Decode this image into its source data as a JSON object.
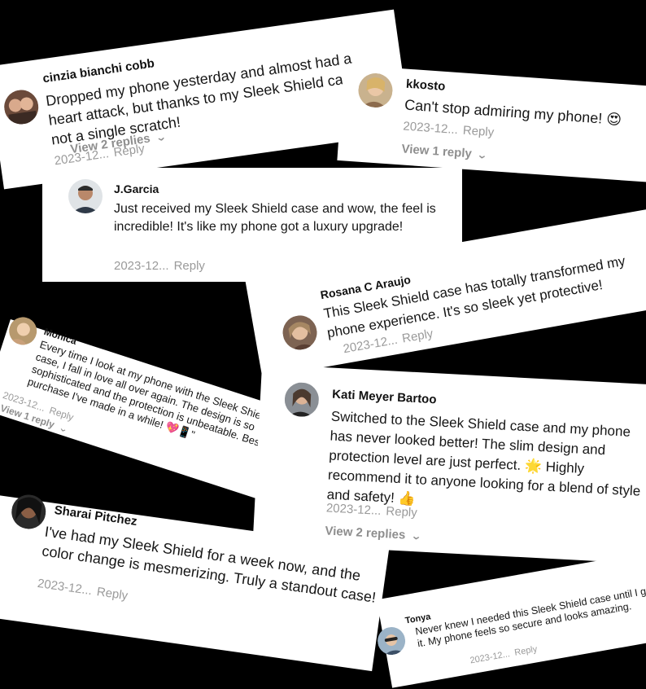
{
  "comments": [
    {
      "username": "cinzia bianchi cobb",
      "text": "Dropped my phone yesterday and almost had a heart attack, but thanks to my Sleek Shield case, not a single scratch!",
      "date": "2023-12...",
      "reply": "Reply",
      "view_replies": "View 2 replies"
    },
    {
      "username": "kkosto",
      "text": "Can't stop admiring my phone! 😍",
      "date": "2023-12...",
      "reply": "Reply",
      "view_replies": "View 1 reply"
    },
    {
      "username": "J.Garcia",
      "text": "Just received my Sleek Shield case and wow, the feel is incredible! It's like my phone got a luxury upgrade!",
      "date": "2023-12...",
      "reply": "Reply"
    },
    {
      "username": "Rosana C Araujo",
      "text": "This Sleek Shield case has totally transformed my phone experience. It's so sleek yet protective!",
      "date": "2023-12...",
      "reply": "Reply"
    },
    {
      "username": "Monica",
      "text": "Every time I look at my phone with the Sleek Shield case, I fall in love all over again. The design is so sophisticated and the protection is unbeatable. Best purchase I've made in a while! 💖📱\"",
      "date": "2023-12...",
      "reply": "Reply",
      "view_replies": "View 1 reply"
    },
    {
      "username": "Kati Meyer Bartoo",
      "text": "Switched to the Sleek Shield case and my phone has never looked better! The slim design and protection level are just perfect. 🌟 Highly recommend it to anyone looking for a blend of style and safety! 👍",
      "date": "2023-12...",
      "reply": "Reply",
      "view_replies": "View 2 replies"
    },
    {
      "username": "Sharai Pitchez",
      "text": "I've had my Sleek Shield for a week now, and the color change is mesmerizing. Truly a standout case!",
      "date": "2023-12...",
      "reply": "Reply"
    },
    {
      "username": "Tonya",
      "text": "Never knew I needed this Sleek Shield case until I got it. My phone feels so secure and looks amazing.",
      "date": "2023-12...",
      "reply": "Reply"
    }
  ],
  "icons": {
    "chevron": "chevron-down-icon"
  },
  "colors": {
    "background": "#000000",
    "card": "#ffffff",
    "text": "#161616",
    "meta": "#9a9a9a"
  }
}
